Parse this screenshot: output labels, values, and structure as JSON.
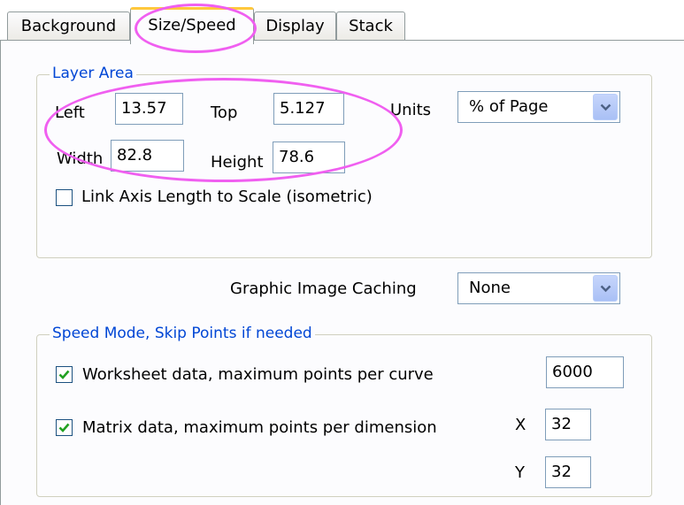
{
  "tabs": [
    {
      "label": "Background"
    },
    {
      "label": "Size/Speed"
    },
    {
      "label": "Display"
    },
    {
      "label": "Stack"
    }
  ],
  "layer_area": {
    "title": "Layer Area",
    "left_label": "Left",
    "left_value": "13.57",
    "top_label": "Top",
    "top_value": "5.127",
    "width_label": "Width",
    "width_value": "82.8",
    "height_label": "Height",
    "height_value": "78.6",
    "units_label": "Units",
    "units_value": "% of Page",
    "link_axis_label": "Link Axis Length to Scale (isometric)",
    "link_axis_checked": false
  },
  "caching": {
    "label": "Graphic Image Caching",
    "value": "None"
  },
  "speed_mode": {
    "title": "Speed Mode, Skip Points if needed",
    "worksheet_label": "Worksheet data, maximum points per curve",
    "worksheet_checked": true,
    "worksheet_value": "6000",
    "matrix_label": "Matrix data, maximum points per dimension",
    "matrix_checked": true,
    "x_label": "X",
    "x_value": "32",
    "y_label": "Y",
    "y_value": "32"
  },
  "colors": {
    "group_title": "#0046d5",
    "highlight": "#f05ff0",
    "active_tab_accent": "#ffc83c"
  }
}
